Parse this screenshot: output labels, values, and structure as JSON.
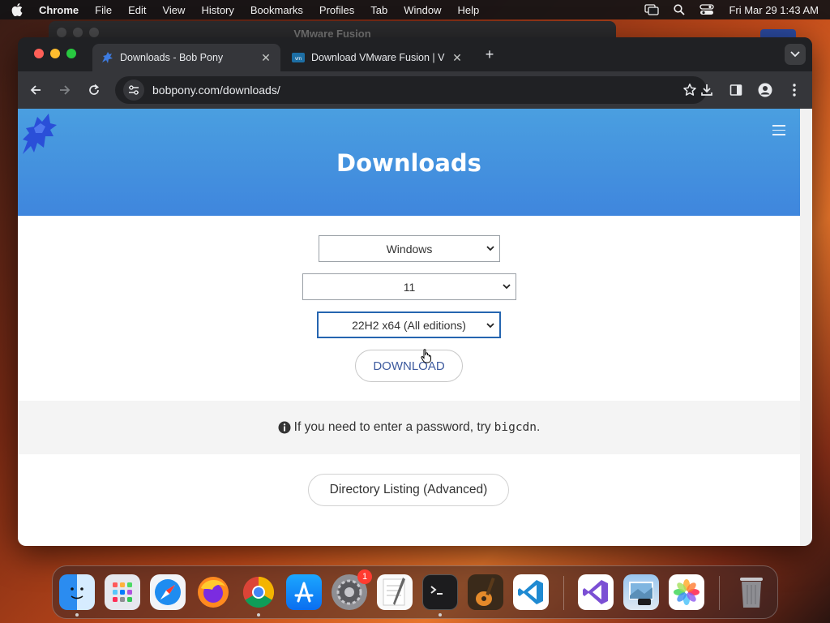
{
  "menubar": {
    "app_name": "Chrome",
    "items": [
      "File",
      "Edit",
      "View",
      "History",
      "Bookmarks",
      "Profiles",
      "Tab",
      "Window",
      "Help"
    ],
    "datetime": "Fri Mar 29  1:43 AM"
  },
  "background_window": {
    "title": "VMware Fusion"
  },
  "browser": {
    "tabs": [
      {
        "title": "Downloads - Bob Pony",
        "active": true
      },
      {
        "title": "Download VMware Fusion | V",
        "active": false
      }
    ],
    "url": "bobpony.com/downloads/"
  },
  "page": {
    "heading": "Downloads",
    "os_select": {
      "value": "Windows"
    },
    "version_select": {
      "value": "11"
    },
    "build_select": {
      "value": "22H2 x64 (All editions)"
    },
    "download_button": "DOWNLOAD",
    "notice": {
      "text": "If you need to enter a password, try",
      "code": "bigcdn",
      "end": "."
    },
    "directory_button": "Directory Listing (Advanced)"
  },
  "dock": {
    "apps": [
      "finder-icon",
      "launchpad-icon",
      "safari-icon",
      "firefox-icon",
      "chrome-icon",
      "app-store-icon",
      "system-settings-icon",
      "textedit-icon",
      "terminal-icon",
      "garageband-icon",
      "vscode-icon",
      "visual-studio-icon",
      "preview-icon",
      "photos-icon",
      "trash-icon"
    ],
    "settings_badge": "1"
  },
  "colors": {
    "hero": "#3f86dd",
    "focus": "#2565b0",
    "button_text": "#3d5a9e"
  }
}
